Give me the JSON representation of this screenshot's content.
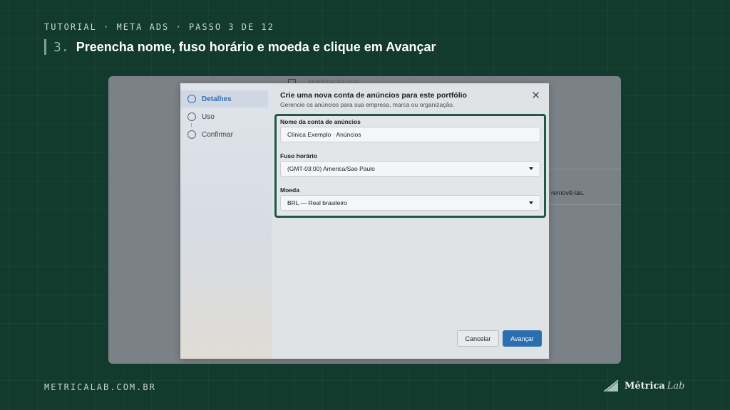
{
  "header": {
    "eyebrow": "TUTORIAL · META ADS · PASSO 3 DE 12",
    "step_number": "3.",
    "title": "Preencha nome, fuso horário e moeda e clique em Avançar"
  },
  "background_page": {
    "nav_label": "Identificação usuá",
    "remove_text": "removê-las."
  },
  "modal": {
    "title": "Crie uma nova conta de anúncios para este portfólio",
    "subtitle": "Gerencie os anúncios para sua empresa, marca ou organização.",
    "close_symbol": "✕",
    "steps": [
      {
        "label": "Detalhes",
        "active": true
      },
      {
        "label": "Uso",
        "active": false
      },
      {
        "label": "Confirmar",
        "active": false
      }
    ],
    "fields": {
      "account_name": {
        "label": "Nome da conta de anúncios",
        "value": "Clínica Exemplo · Anúncios"
      },
      "timezone": {
        "label": "Fuso horário",
        "value": "(GMT-03:00) America/Sao Paulo"
      },
      "currency": {
        "label": "Moeda",
        "value": "BRL — Real brasileiro"
      }
    },
    "buttons": {
      "cancel": "Cancelar",
      "next": "Avançar"
    }
  },
  "footer": {
    "url": "METRICALAB.COM.BR",
    "brand_word_1": "Métrica",
    "brand_word_2": "Lab"
  },
  "colors": {
    "background": "#123a2d",
    "highlight_border": "#1f5a48",
    "primary_button": "#2a6fb0",
    "active_step": "#2f6fb2"
  }
}
